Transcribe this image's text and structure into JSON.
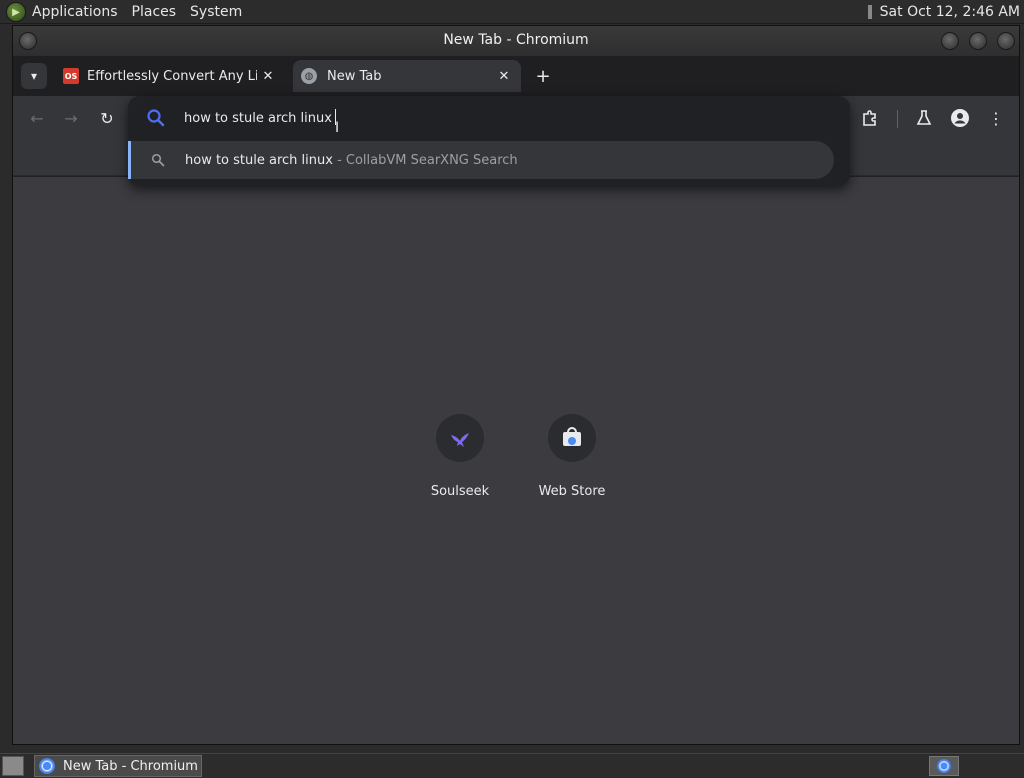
{
  "top_panel": {
    "menus": [
      "Applications",
      "Places",
      "System"
    ],
    "clock": "Sat Oct 12,  2:46 AM"
  },
  "window": {
    "title": "New Tab - Chromium"
  },
  "tabs": [
    {
      "label": "Effortlessly Convert Any Linux",
      "favicon": "os-icon",
      "active": false
    },
    {
      "label": "New Tab",
      "favicon": "globe-icon",
      "active": true
    }
  ],
  "omnibox": {
    "input_value": "how to stule arch linux",
    "suggestion": {
      "query": "how to stule arch linux",
      "source": " - CollabVM SearXNG Search"
    }
  },
  "shortcuts": [
    {
      "label": "Soulseek",
      "icon": "bird-icon"
    },
    {
      "label": "Web Store",
      "icon": "webstore-icon"
    }
  ],
  "taskbar": {
    "items": [
      {
        "label": "New Tab - Chromium",
        "icon": "chromium-icon"
      }
    ]
  },
  "colors": {
    "accent": "#8ab4f8",
    "search_icon": "#4c6ef5",
    "content_bg": "#3c3c40"
  }
}
